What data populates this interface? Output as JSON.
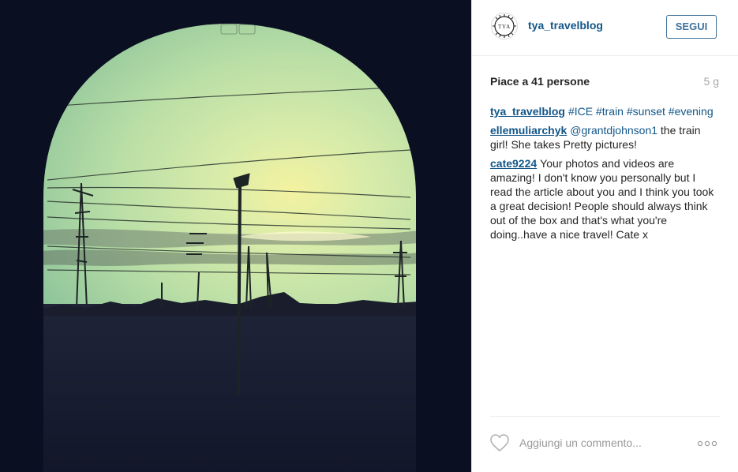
{
  "post": {
    "username": "tya_travelblog",
    "avatar_text": "TYA",
    "follow_label": "SEGUI",
    "likes_text": "Piace a 41 persone",
    "time_ago": "5 g"
  },
  "caption": {
    "author": "tya_travelblog",
    "text": "#ICE #train #sunset #evening"
  },
  "comments": [
    {
      "author": "ellemuliarchyk",
      "mention": "@grantdjohnson1",
      "text": "the train girl! She takes Pretty pictures!"
    },
    {
      "author": "cate9224",
      "mention": "",
      "text": "Your photos and videos are amazing! I don't know you personally but I read the article about you and I think you took a great decision! People should always think out of the box and that's what you're doing..have a nice travel! Cate x"
    }
  ],
  "footer": {
    "comment_placeholder": "Aggiungi un commento...",
    "like_icon": "heart-icon",
    "more_icon": "ellipsis-icon"
  },
  "colors": {
    "link": "#125688",
    "follow_border": "#3f729b",
    "muted": "#a5a7aa"
  }
}
